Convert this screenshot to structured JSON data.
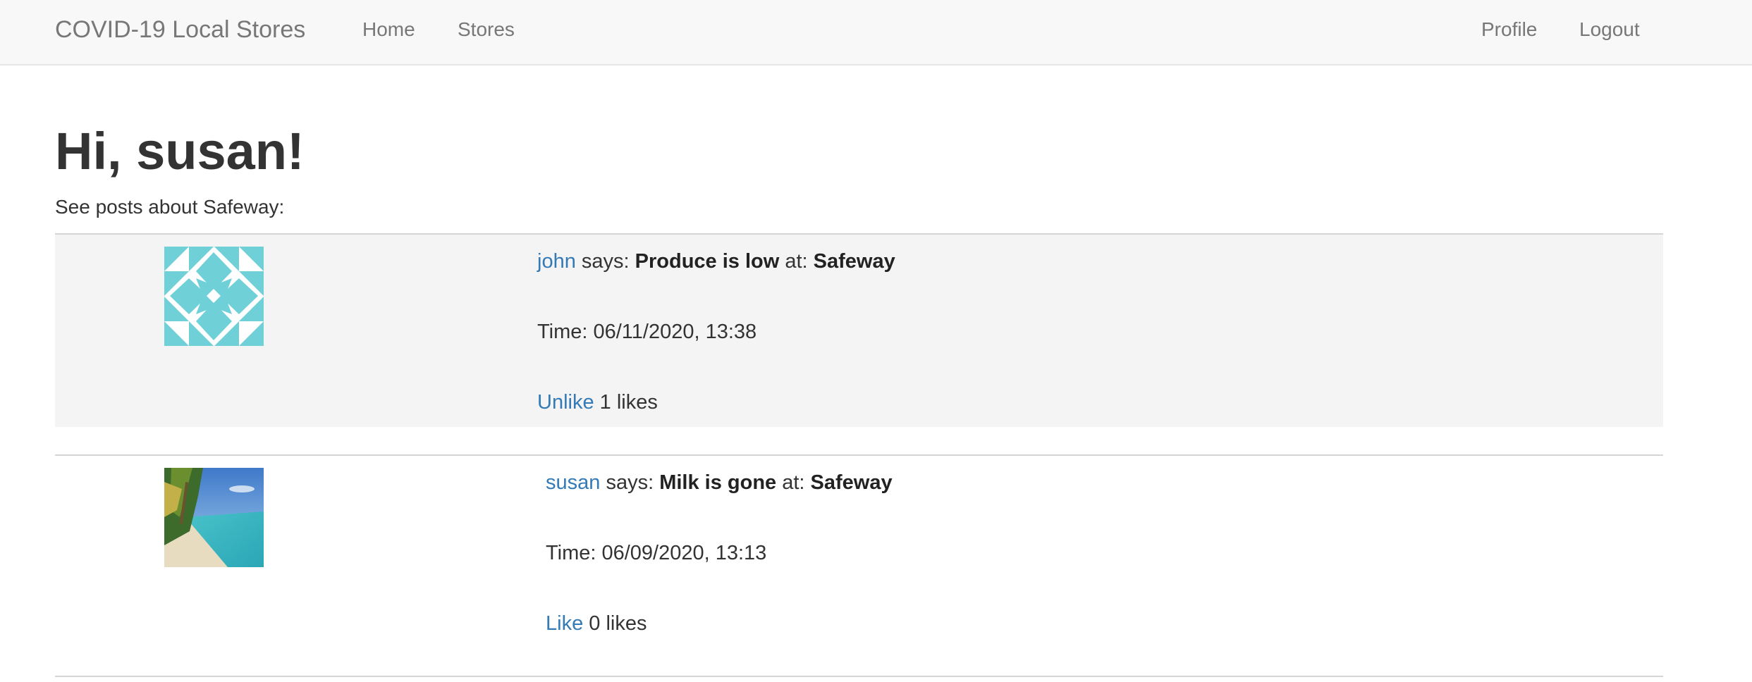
{
  "navbar": {
    "brand": "COVID-19 Local Stores",
    "links": {
      "home": "Home",
      "stores": "Stores",
      "profile": "Profile",
      "logout": "Logout"
    }
  },
  "page": {
    "greeting": "Hi, susan!",
    "subtitle": "See posts about Safeway:"
  },
  "posts": [
    {
      "author": "john",
      "says": " says: ",
      "message": "Produce is low",
      "at": " at: ",
      "store": "Safeway",
      "time": "Time: 06/11/2020, 13:38",
      "like_action": "Unlike",
      "likes": " 1 likes",
      "avatar_icon": "identicon-avatar"
    },
    {
      "author": "susan",
      "says": " says: ",
      "message": "Milk is gone",
      "at": " at: ",
      "store": "Safeway",
      "time": "Time: 06/09/2020, 13:13",
      "like_action": "Like",
      "likes": " 0 likes",
      "avatar_icon": "beach-photo-avatar"
    }
  ],
  "colors": {
    "link": "#337ab7",
    "navbar_bg": "#f8f8f8",
    "post_highlight": "#f4f4f4",
    "identicon": "#6fd0d8"
  }
}
